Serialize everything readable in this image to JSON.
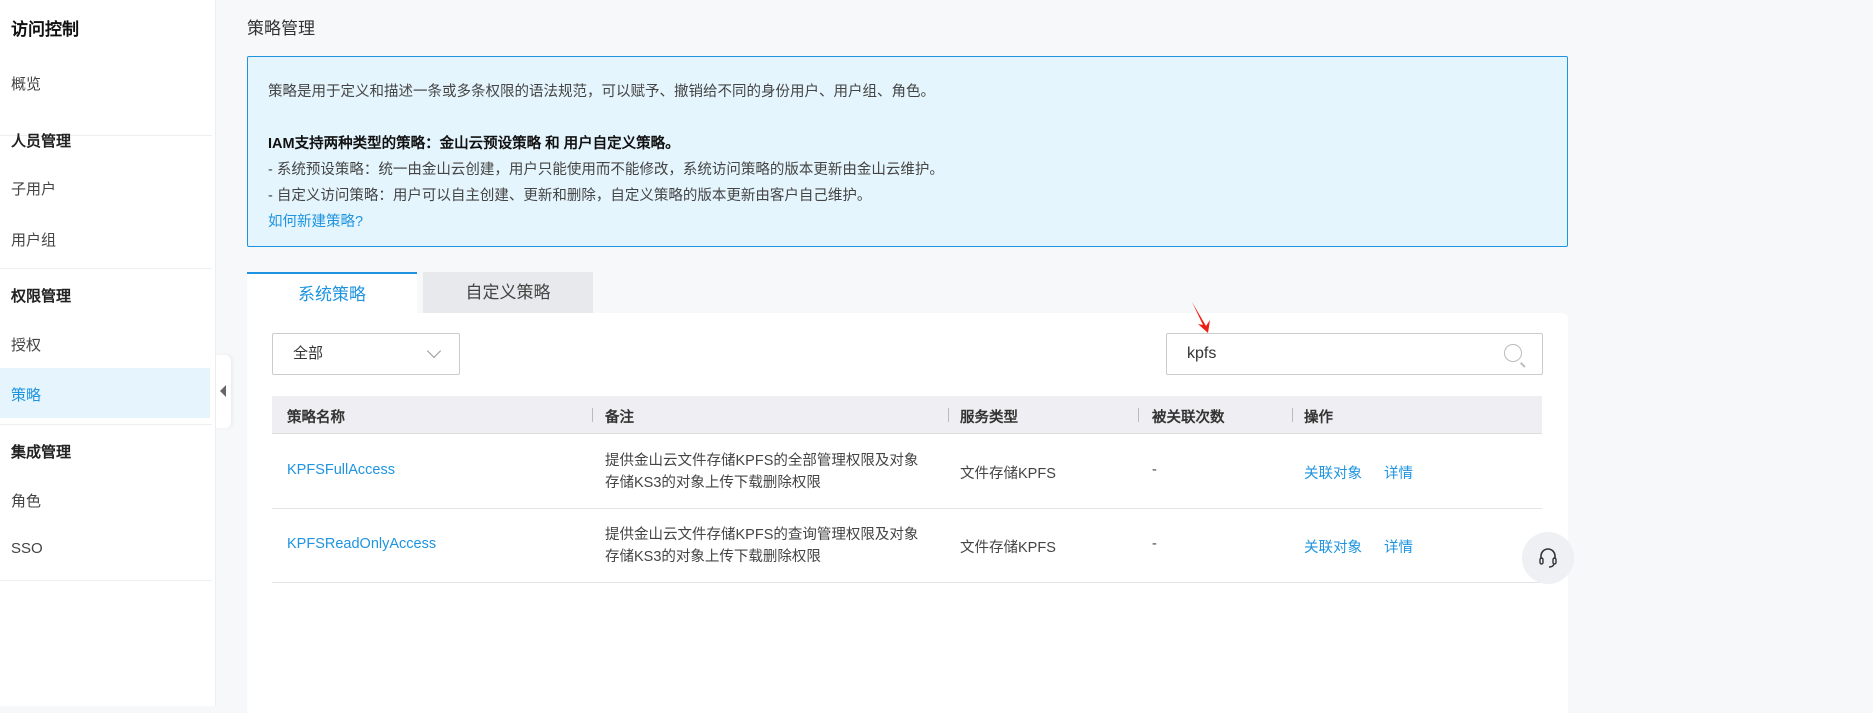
{
  "sidebar": {
    "title": "访问控制",
    "overview": "概览",
    "groups": [
      {
        "label": "人员管理",
        "items": [
          "子用户",
          "用户组"
        ]
      },
      {
        "label": "权限管理",
        "items": [
          "授权",
          "策略"
        ]
      },
      {
        "label": "集成管理",
        "items": [
          "角色",
          "SSO"
        ]
      }
    ],
    "active": "策略"
  },
  "page_title": "策略管理",
  "info": {
    "line1": "策略是用于定义和描述一条或多条权限的语法规范，可以赋予、撤销给不同的身份用户、用户组、角色。",
    "line2": "IAM支持两种类型的策略：金山云预设策略 和 用户自定义策略。",
    "line3": "- 系统预设策略：统一由金山云创建，用户只能使用而不能修改，系统访问策略的版本更新由金山云维护。",
    "line4": "- 自定义访问策略：用户可以自主创建、更新和删除，自定义策略的版本更新由客户自己维护。",
    "link": "如何新建策略?"
  },
  "tabs": [
    "系统策略",
    "自定义策略"
  ],
  "filter": {
    "selected": "全部"
  },
  "search": {
    "value": "kpfs"
  },
  "table": {
    "headers": [
      "策略名称",
      "备注",
      "服务类型",
      "被关联次数",
      "操作"
    ],
    "rows": [
      {
        "name": "KPFSFullAccess",
        "note1": "提供金山云文件存储KPFS的全部管理权限及对象",
        "note2": "存储KS3的对象上传下载删除权限",
        "service": "文件存储KPFS",
        "count": "-",
        "actions": [
          "关联对象",
          "详情"
        ]
      },
      {
        "name": "KPFSReadOnlyAccess",
        "note1": "提供金山云文件存储KPFS的查询管理权限及对象",
        "note2": "存储KS3的对象上传下载删除权限",
        "service": "文件存储KPFS",
        "count": "-",
        "actions": [
          "关联对象",
          "详情"
        ]
      }
    ]
  },
  "colors": {
    "accent": "#1e94e0",
    "info_bg": "#e5f5fd"
  }
}
